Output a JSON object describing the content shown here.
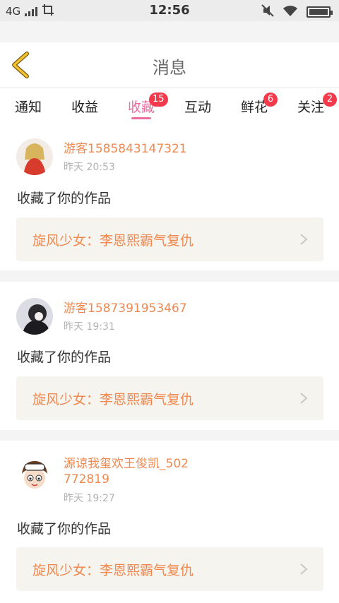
{
  "status": {
    "network": "4G",
    "time": "12:56"
  },
  "header": {
    "title": "消息"
  },
  "tabs": [
    {
      "label": "通知",
      "badge": ""
    },
    {
      "label": "收益",
      "badge": ""
    },
    {
      "label": "收藏",
      "badge": "15",
      "active": true
    },
    {
      "label": "互动",
      "badge": ""
    },
    {
      "label": "鲜花",
      "badge": "6"
    },
    {
      "label": "关注",
      "badge": "2"
    }
  ],
  "items": [
    {
      "user": "游客1585843147321",
      "time": "昨天 20:53",
      "action": "收藏了你的作品",
      "work": "旋风少女：李恩熙霸气复仇"
    },
    {
      "user": "游客1587391953467",
      "time": "昨天 19:31",
      "action": "收藏了你的作品",
      "work": "旋风少女：李恩熙霸气复仇"
    },
    {
      "user": "源谅我玺欢王俊凯_502772819",
      "time": "昨天 19:27",
      "action": "收藏了你的作品",
      "work": "旋风少女：李恩熙霸气复仇"
    }
  ],
  "colors": {
    "accent": "#ea6fa0",
    "username": "#f0884f",
    "badge": "#f23a4c",
    "back_arrow": "#f2c230"
  }
}
